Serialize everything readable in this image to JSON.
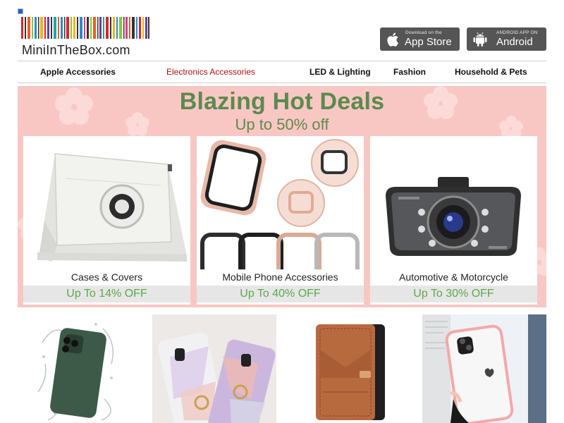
{
  "header": {
    "logo_text": "MiniInTheBox.com",
    "apple_button": {
      "small": "Download on the",
      "big": "App Store"
    },
    "android_button": {
      "small": "ANDROID APP ON",
      "big": "Android"
    }
  },
  "nav": {
    "items": [
      {
        "label": "Apple Accessories",
        "active": false
      },
      {
        "label": "Electronics Accessories",
        "active": true
      },
      {
        "label": "LED & Lighting",
        "active": false
      },
      {
        "label": "Fashion",
        "active": false
      },
      {
        "label": "Household & Pets",
        "active": false
      }
    ]
  },
  "banner": {
    "title": "Blazing Hot Deals",
    "subtitle": "Up to 50% off",
    "cards": [
      {
        "name": "Cases & Covers",
        "deal": "Up To 14% OFF",
        "image": "white-tablet-case"
      },
      {
        "name": "Mobile Phone Accessories",
        "deal": "Up To 40% OFF",
        "image": "watch-bumper-cases"
      },
      {
        "name": "Automotive & Motorcycle",
        "deal": "Up To 30% OFF",
        "image": "car-dash-camera"
      }
    ]
  },
  "products": [
    {
      "image": "green-phone-case-splash"
    },
    {
      "image": "marble-phone-cases"
    },
    {
      "image": "leather-wallet-case"
    },
    {
      "image": "clear-pink-bumper-case"
    }
  ],
  "colors": {
    "accent_green": "#5c8a4e",
    "deal_green": "#5ea84b",
    "active_nav": "#b31010",
    "banner_bg": "#f9c7c3",
    "store_button": "#555555"
  }
}
